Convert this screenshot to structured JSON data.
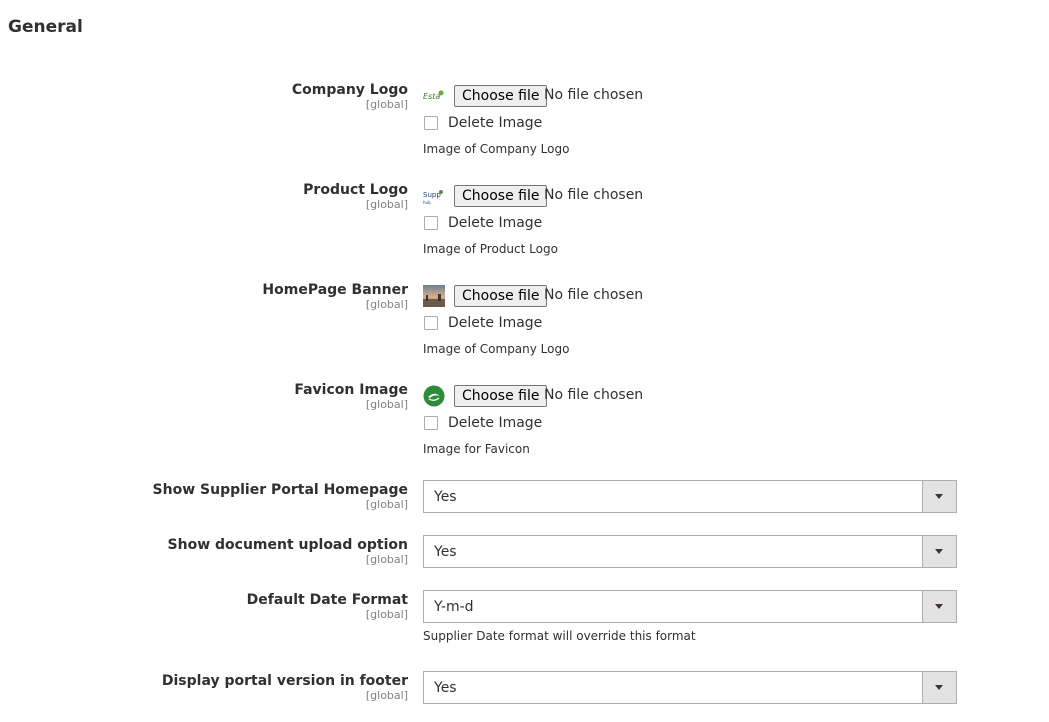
{
  "section": {
    "title": "General"
  },
  "file_fields": [
    {
      "label": "Company Logo",
      "scope": "[global]",
      "button": "Choose file",
      "status": "No file chosen",
      "delete_label": "Delete Image",
      "note": "Image of Company Logo",
      "thumb_icon": "company-logo-thumbnail"
    },
    {
      "label": "Product Logo",
      "scope": "[global]",
      "button": "Choose file",
      "status": "No file chosen",
      "delete_label": "Delete Image",
      "note": "Image of Product Logo",
      "thumb_icon": "product-logo-thumbnail"
    },
    {
      "label": "HomePage Banner",
      "scope": "[global]",
      "button": "Choose file",
      "status": "No file chosen",
      "delete_label": "Delete Image",
      "note": "Image of Company Logo",
      "thumb_icon": "banner-thumbnail"
    },
    {
      "label": "Favicon Image",
      "scope": "[global]",
      "button": "Choose file",
      "status": "No file chosen",
      "delete_label": "Delete Image",
      "note": "Image for Favicon",
      "thumb_icon": "favicon-thumbnail"
    }
  ],
  "select_fields": [
    {
      "label": "Show Supplier Portal Homepage",
      "scope": "[global]",
      "value": "Yes",
      "note": ""
    },
    {
      "label": "Show document upload option",
      "scope": "[global]",
      "value": "Yes",
      "note": ""
    },
    {
      "label": "Default Date Format",
      "scope": "[global]",
      "value": "Y-m-d",
      "note": "Supplier Date format will override this format"
    },
    {
      "label": "Display portal version in footer",
      "scope": "[global]",
      "value": "Yes",
      "note": ""
    }
  ],
  "colors": {
    "favicon": "#2e8b3a",
    "arrow_bg": "#e3e3e3",
    "border": "#adadad"
  }
}
